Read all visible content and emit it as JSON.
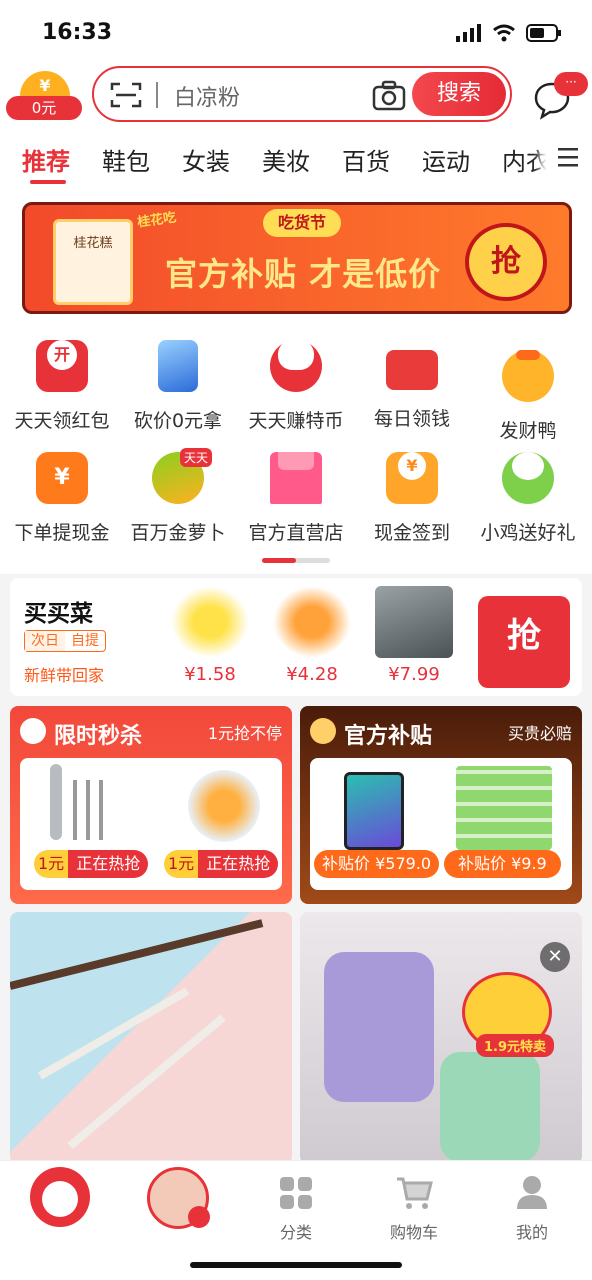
{
  "status": {
    "time": "16:33"
  },
  "header": {
    "coin_amount": "0元",
    "coin_symbol": "¥",
    "search_keyword": "白凉粉",
    "search_button": "搜索",
    "message_badge": "···"
  },
  "tabs": [
    "推荐",
    "鞋包",
    "女装",
    "美妆",
    "百货",
    "运动",
    "内衣"
  ],
  "banner": {
    "tag": "桂花吃",
    "festival": "吃货节",
    "slogan": "官方补贴 才是低价",
    "grab": "抢",
    "pack_label": "桂花糕"
  },
  "shortcuts": [
    {
      "label": "天天领红包",
      "icon": "red-packet-icon",
      "glyph": "开"
    },
    {
      "label": "砍价0元拿",
      "icon": "phone-icon",
      "glyph": ""
    },
    {
      "label": "天天赚特币",
      "icon": "cat-coin-icon",
      "glyph": ""
    },
    {
      "label": "每日领钱",
      "icon": "wallet-icon",
      "glyph": ""
    },
    {
      "label": "发财鸭",
      "icon": "duck-icon",
      "glyph": ""
    },
    {
      "label": "下单提现金",
      "icon": "cash-bag-icon",
      "glyph": "¥"
    },
    {
      "label": "百万金萝卜",
      "icon": "carrot-icon",
      "glyph": ""
    },
    {
      "label": "官方直营店",
      "icon": "store-icon",
      "glyph": ""
    },
    {
      "label": "现金签到",
      "icon": "calendar-coin-icon",
      "glyph": "¥"
    },
    {
      "label": "小鸡送好礼",
      "icon": "chick-icon",
      "glyph": ""
    }
  ],
  "carrot_badge": "天天",
  "maicai": {
    "title": "买买菜",
    "tag_left": "次日",
    "tag_right": "自提",
    "subtitle": "新鲜带回家",
    "products": [
      {
        "price": "¥1.58",
        "icon": "banana-icon"
      },
      {
        "price": "¥4.28",
        "icon": "melon-icon"
      },
      {
        "price": "¥7.99",
        "icon": "fish-icon"
      }
    ],
    "grab": "抢"
  },
  "flash_sale": {
    "title": "限时秒杀",
    "slogan": "1元抢不停",
    "items": [
      {
        "price": "1元",
        "action": "正在热抢"
      },
      {
        "price": "1元",
        "action": "正在热抢"
      }
    ]
  },
  "subsidy": {
    "title": "官方补贴",
    "slogan": "买贵必赔",
    "items": [
      {
        "price": "补贴价 ¥579.0"
      },
      {
        "price": "补贴价 ¥9.9"
      }
    ]
  },
  "feed_right_sticker": "1.9元特卖",
  "bottom_nav": [
    {
      "label": "",
      "icon": "rabbit-home-icon"
    },
    {
      "label": "",
      "icon": "live-avatar-icon"
    },
    {
      "label": "分类",
      "icon": "category-icon"
    },
    {
      "label": "购物车",
      "icon": "cart-icon"
    },
    {
      "label": "我的",
      "icon": "profile-icon"
    }
  ],
  "colors": {
    "accent": "#e8323a",
    "orange": "#ff6a1a",
    "subsidy_dark": "#5a2a10"
  }
}
